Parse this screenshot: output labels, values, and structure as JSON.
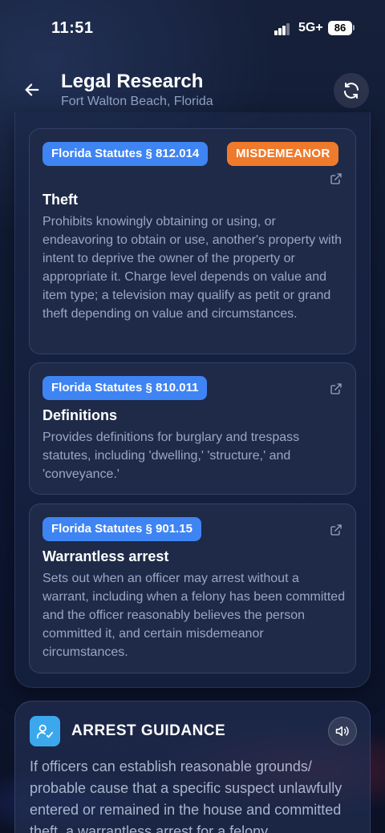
{
  "status_bar": {
    "time": "11:51",
    "network": "5G+",
    "battery": "86"
  },
  "header": {
    "title": "Legal Research",
    "subtitle": "Fort Walton Beach, Florida",
    "back_icon": "arrow-left-icon",
    "refresh_icon": "refresh-icon"
  },
  "statutes": [
    {
      "citation": "Florida Statutes § 812.014",
      "level": "MISDEMEANOR",
      "title": "Theft",
      "description": "Prohibits knowingly obtaining or using, or endeavoring to obtain or use, another's property with intent to deprive the owner of the property or appropriate it. Charge level depends on value and item type; a television may qualify as petit or grand theft depending on value and circumstances."
    },
    {
      "citation": "Florida Statutes § 810.011",
      "title": "Definitions",
      "description": "Provides definitions for burglary and trespass statutes, including 'dwelling,' 'structure,' and 'conveyance.'"
    },
    {
      "citation": "Florida Statutes § 901.15",
      "title": "Warrantless arrest",
      "description": "Sets out when an officer may arrest without a warrant, including when a felony has been committed and the officer reasonably believes the person committed it, and certain misdemeanor circumstances."
    }
  ],
  "guidance": {
    "title": "ARREST GUIDANCE",
    "text": "If officers can establish reasonable grounds/ probable cause that a specific suspect unlawfully entered or remained in the house and committed theft, a warrantless arrest for a felony"
  },
  "colors": {
    "badge_blue": "#3f84f3",
    "badge_orange": "#f07a2b",
    "guidance_icon": "#3ba8ee"
  }
}
